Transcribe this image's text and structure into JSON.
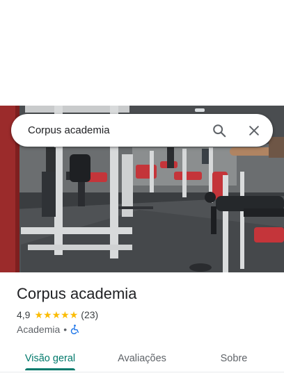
{
  "search": {
    "query": "Corpus academia",
    "search_icon": "magnifier-icon",
    "close_icon": "close-icon"
  },
  "place": {
    "name": "Corpus academia",
    "rating": "4,9",
    "stars": 5,
    "review_count": "(23)",
    "category": "Academia",
    "separator": "•",
    "accessibility_icon": "wheelchair-icon"
  },
  "tabs": [
    {
      "label": "Visão geral",
      "active": true
    },
    {
      "label": "Avaliações",
      "active": false
    },
    {
      "label": "Sobre",
      "active": false
    }
  ],
  "colors": {
    "accent": "#00796b",
    "star": "#fbbc04",
    "accessibility": "#1a73e8"
  }
}
